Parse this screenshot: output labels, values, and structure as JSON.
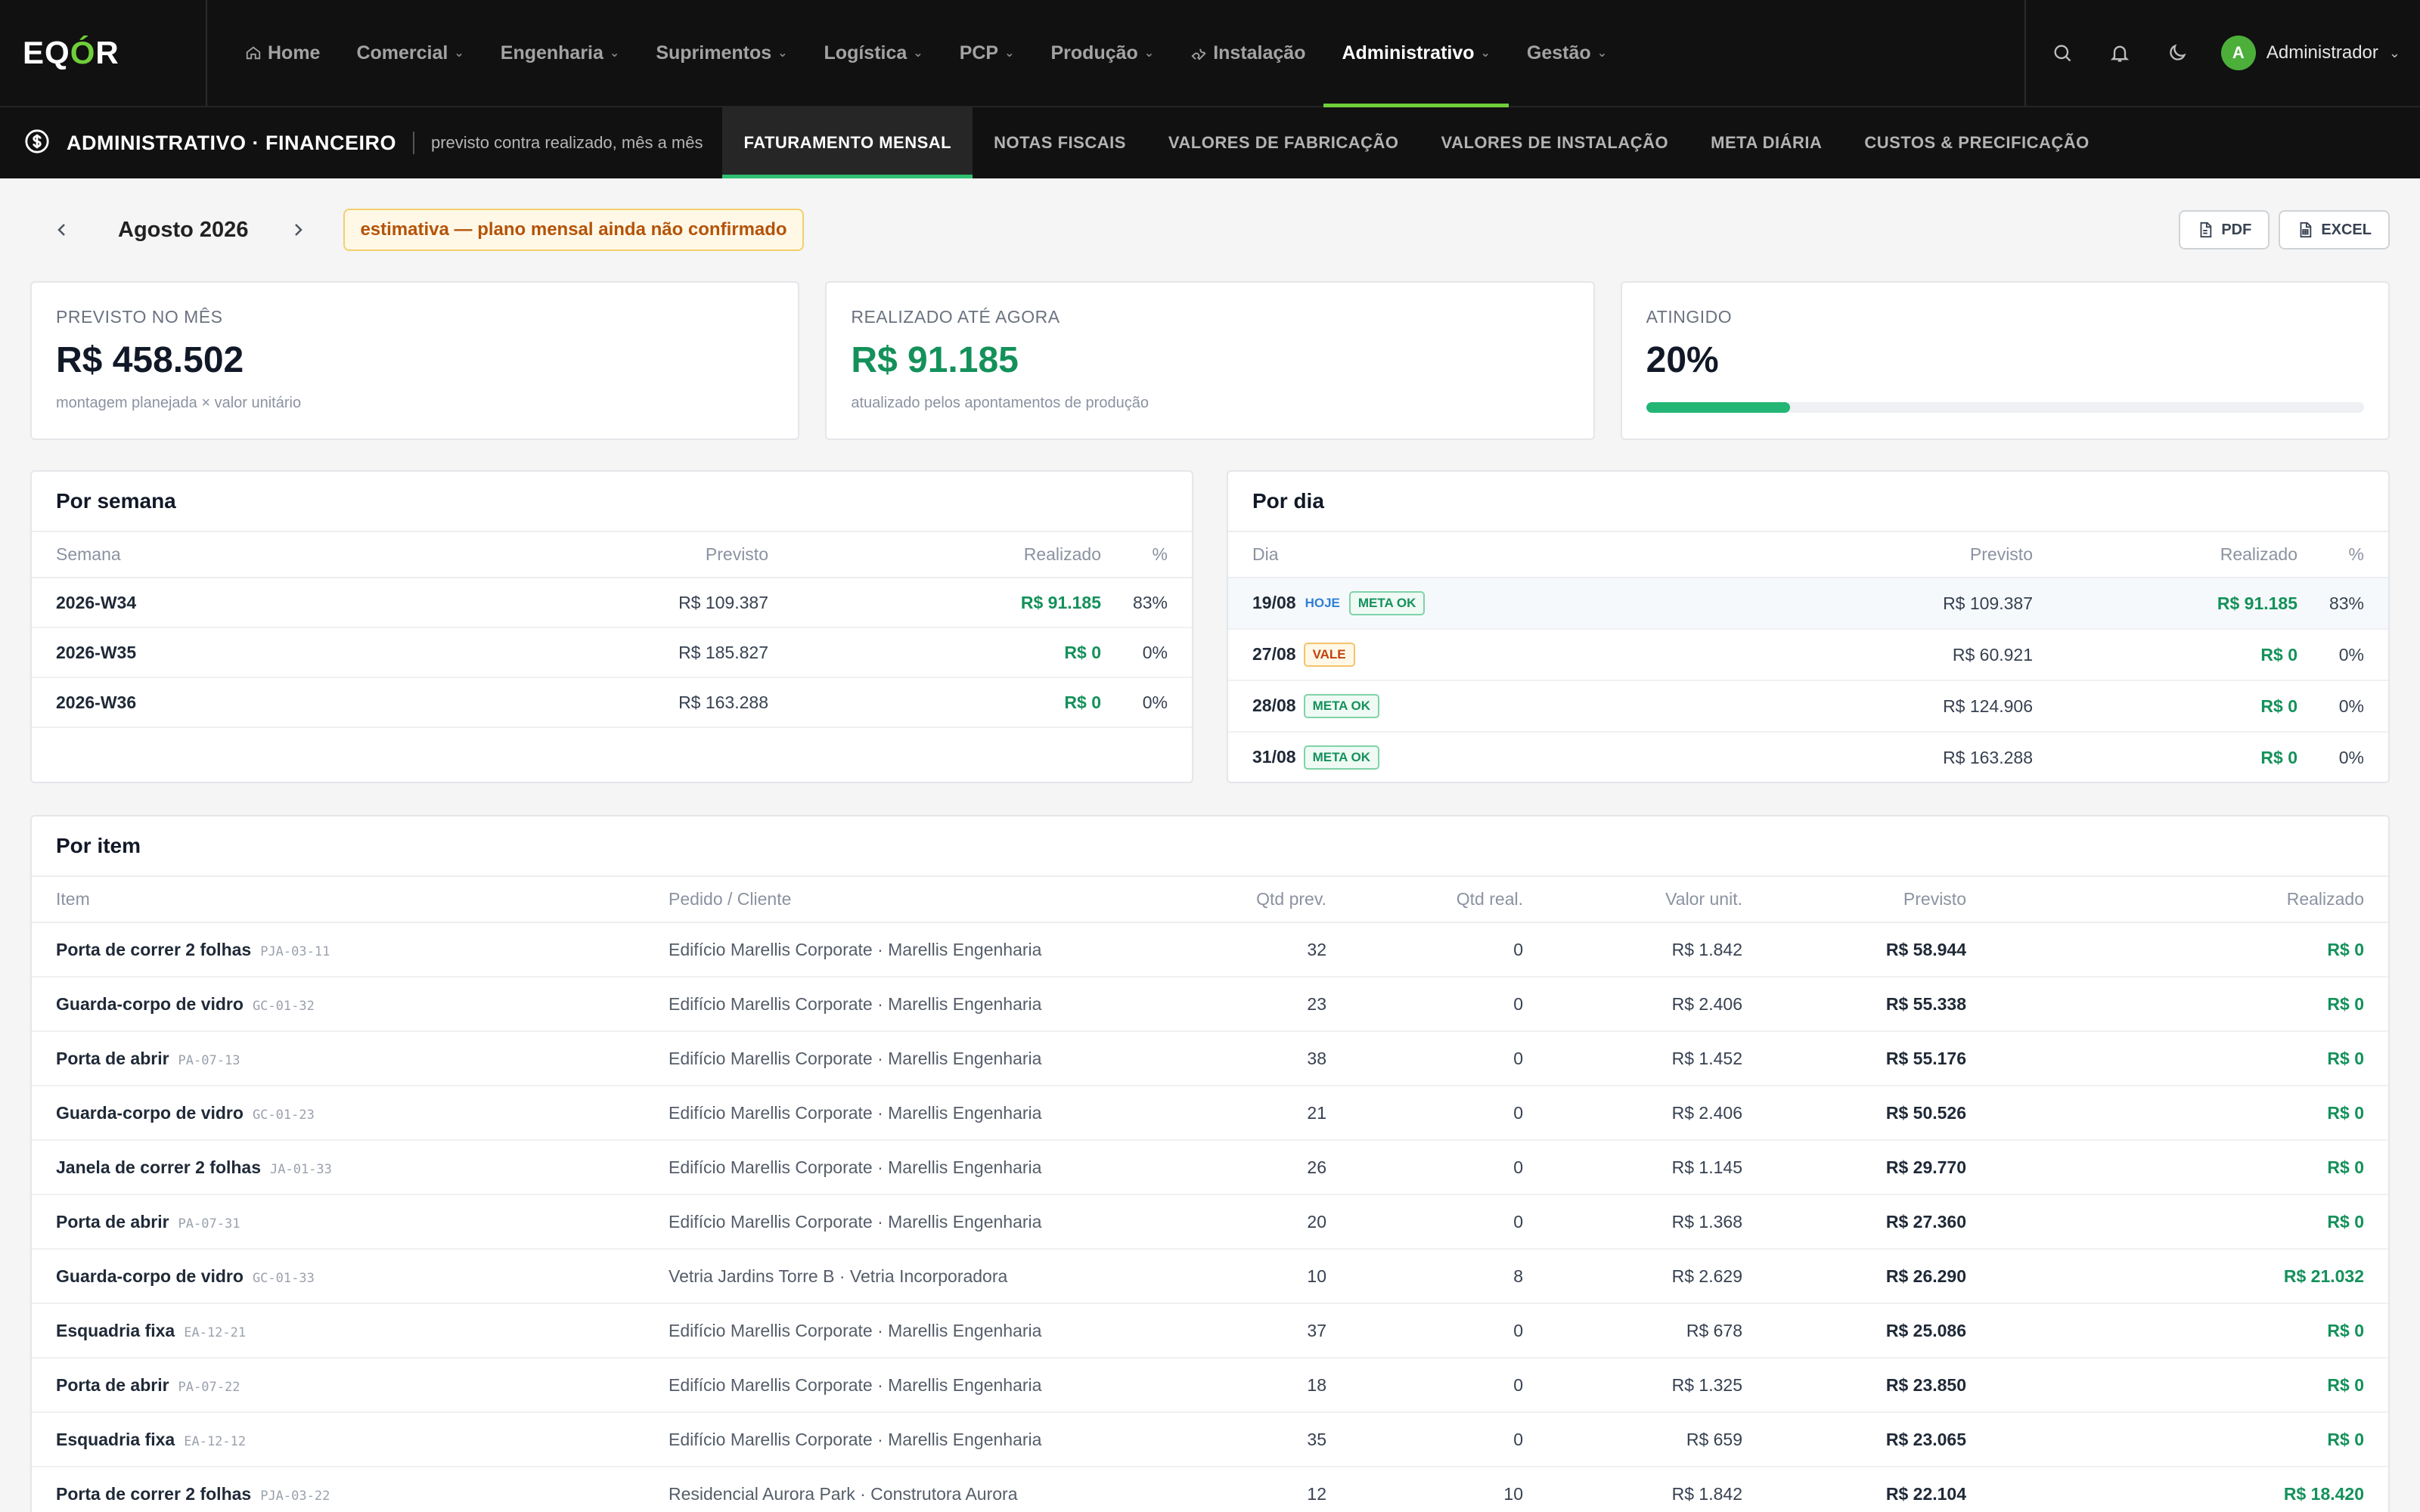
{
  "brand": {
    "logo_prefix": "EQ",
    "logo_accent": "Ó",
    "logo_suffix": "R",
    "accent": "#6fcf3b"
  },
  "nav": {
    "items": [
      {
        "label": "Home",
        "icon": "home-icon",
        "dropdown": false,
        "active": false
      },
      {
        "label": "Comercial",
        "dropdown": true,
        "active": false
      },
      {
        "label": "Engenharia",
        "dropdown": true,
        "active": false
      },
      {
        "label": "Suprimentos",
        "dropdown": true,
        "active": false
      },
      {
        "label": "Logística",
        "dropdown": true,
        "active": false
      },
      {
        "label": "PCP",
        "dropdown": true,
        "active": false
      },
      {
        "label": "Produção",
        "dropdown": true,
        "active": false
      },
      {
        "label": "Instalação",
        "icon": "wrench-icon",
        "dropdown": false,
        "active": false
      },
      {
        "label": "Administrativo",
        "dropdown": true,
        "active": true
      },
      {
        "label": "Gestão",
        "dropdown": true,
        "active": false
      }
    ],
    "user": {
      "initial": "A",
      "name": "Administrador"
    }
  },
  "subnav": {
    "section_title": "ADMINISTRATIVO · FINANCEIRO",
    "section_desc": "previsto contra realizado, mês a mês",
    "tabs": [
      "FATURAMENTO MENSAL",
      "NOTAS FISCAIS",
      "VALORES DE FABRICAÇÃO",
      "VALORES DE INSTALAÇÃO",
      "META DIÁRIA",
      "CUSTOS & PRECIFICAÇÃO"
    ],
    "active_tab": 0
  },
  "toolbar": {
    "month": "Agosto 2026",
    "estimate_notice": "estimativa — plano mensal ainda não confirmado",
    "pdf_label": "PDF",
    "excel_label": "EXCEL"
  },
  "kpis": {
    "previsto": {
      "label": "PREVISTO NO MÊS",
      "value": "R$ 458.502",
      "note": "montagem planejada × valor unitário"
    },
    "realizado": {
      "label": "REALIZADO ATÉ AGORA",
      "value": "R$ 91.185",
      "note": "atualizado pelos apontamentos de produção"
    },
    "atingido": {
      "label": "ATINGIDO",
      "value": "20%",
      "progress": 0.2
    }
  },
  "por_semana": {
    "title": "Por semana",
    "headers": [
      "Semana",
      "Previsto",
      "Realizado",
      "%"
    ],
    "rows": [
      {
        "semana": "2026-W34",
        "previsto": "R$ 109.387",
        "realizado": "R$ 91.185",
        "pct": "83%"
      },
      {
        "semana": "2026-W35",
        "previsto": "R$ 185.827",
        "realizado": "R$ 0",
        "pct": "0%"
      },
      {
        "semana": "2026-W36",
        "previsto": "R$ 163.288",
        "realizado": "R$ 0",
        "pct": "0%"
      }
    ]
  },
  "por_dia": {
    "title": "Por dia",
    "headers": [
      "Dia",
      "Previsto",
      "Realizado",
      "%"
    ],
    "rows": [
      {
        "dia": "19/08",
        "badges": [
          {
            "text": "HOJE",
            "kind": "hoje"
          },
          {
            "text": "META OK",
            "kind": "ok"
          }
        ],
        "previsto": "R$ 109.387",
        "realizado": "R$ 91.185",
        "pct": "83%",
        "today": true
      },
      {
        "dia": "27/08",
        "badges": [
          {
            "text": "VALE",
            "kind": "vale"
          }
        ],
        "previsto": "R$ 60.921",
        "realizado": "R$ 0",
        "pct": "0%",
        "today": false
      },
      {
        "dia": "28/08",
        "badges": [
          {
            "text": "META OK",
            "kind": "ok"
          }
        ],
        "previsto": "R$ 124.906",
        "realizado": "R$ 0",
        "pct": "0%",
        "today": false
      },
      {
        "dia": "31/08",
        "badges": [
          {
            "text": "META OK",
            "kind": "ok"
          }
        ],
        "previsto": "R$ 163.288",
        "realizado": "R$ 0",
        "pct": "0%",
        "today": false
      }
    ]
  },
  "por_item": {
    "title": "Por item",
    "headers": [
      "Item",
      "Pedido / Cliente",
      "Qtd prev.",
      "Qtd real.",
      "Valor unit.",
      "Previsto",
      "Realizado"
    ],
    "rows": [
      {
        "item": "Porta de correr 2 folhas",
        "code": "PJA-03-11",
        "cliente": "Edifício Marellis Corporate · Marellis Engenharia",
        "qtd_prev": "32",
        "qtd_real": "0",
        "valor_unit": "R$ 1.842",
        "previsto": "R$ 58.944",
        "realizado": "R$ 0"
      },
      {
        "item": "Guarda-corpo de vidro",
        "code": "GC-01-32",
        "cliente": "Edifício Marellis Corporate · Marellis Engenharia",
        "qtd_prev": "23",
        "qtd_real": "0",
        "valor_unit": "R$ 2.406",
        "previsto": "R$ 55.338",
        "realizado": "R$ 0"
      },
      {
        "item": "Porta de abrir",
        "code": "PA-07-13",
        "cliente": "Edifício Marellis Corporate · Marellis Engenharia",
        "qtd_prev": "38",
        "qtd_real": "0",
        "valor_unit": "R$ 1.452",
        "previsto": "R$ 55.176",
        "realizado": "R$ 0"
      },
      {
        "item": "Guarda-corpo de vidro",
        "code": "GC-01-23",
        "cliente": "Edifício Marellis Corporate · Marellis Engenharia",
        "qtd_prev": "21",
        "qtd_real": "0",
        "valor_unit": "R$ 2.406",
        "previsto": "R$ 50.526",
        "realizado": "R$ 0"
      },
      {
        "item": "Janela de correr 2 folhas",
        "code": "JA-01-33",
        "cliente": "Edifício Marellis Corporate · Marellis Engenharia",
        "qtd_prev": "26",
        "qtd_real": "0",
        "valor_unit": "R$ 1.145",
        "previsto": "R$ 29.770",
        "realizado": "R$ 0"
      },
      {
        "item": "Porta de abrir",
        "code": "PA-07-31",
        "cliente": "Edifício Marellis Corporate · Marellis Engenharia",
        "qtd_prev": "20",
        "qtd_real": "0",
        "valor_unit": "R$ 1.368",
        "previsto": "R$ 27.360",
        "realizado": "R$ 0"
      },
      {
        "item": "Guarda-corpo de vidro",
        "code": "GC-01-33",
        "cliente": "Vetria Jardins Torre B · Vetria Incorporadora",
        "qtd_prev": "10",
        "qtd_real": "8",
        "valor_unit": "R$ 2.629",
        "previsto": "R$ 26.290",
        "realizado": "R$ 21.032"
      },
      {
        "item": "Esquadria fixa",
        "code": "EA-12-21",
        "cliente": "Edifício Marellis Corporate · Marellis Engenharia",
        "qtd_prev": "37",
        "qtd_real": "0",
        "valor_unit": "R$ 678",
        "previsto": "R$ 25.086",
        "realizado": "R$ 0"
      },
      {
        "item": "Porta de abrir",
        "code": "PA-07-22",
        "cliente": "Edifício Marellis Corporate · Marellis Engenharia",
        "qtd_prev": "18",
        "qtd_real": "0",
        "valor_unit": "R$ 1.325",
        "previsto": "R$ 23.850",
        "realizado": "R$ 0"
      },
      {
        "item": "Esquadria fixa",
        "code": "EA-12-12",
        "cliente": "Edifício Marellis Corporate · Marellis Engenharia",
        "qtd_prev": "35",
        "qtd_real": "0",
        "valor_unit": "R$ 659",
        "previsto": "R$ 23.065",
        "realizado": "R$ 0"
      },
      {
        "item": "Porta de correr 2 folhas",
        "code": "PJA-03-22",
        "cliente": "Residencial Aurora Park · Construtora Aurora",
        "qtd_prev": "12",
        "qtd_real": "10",
        "valor_unit": "R$ 1.842",
        "previsto": "R$ 22.104",
        "realizado": "R$ 18.420"
      }
    ]
  }
}
